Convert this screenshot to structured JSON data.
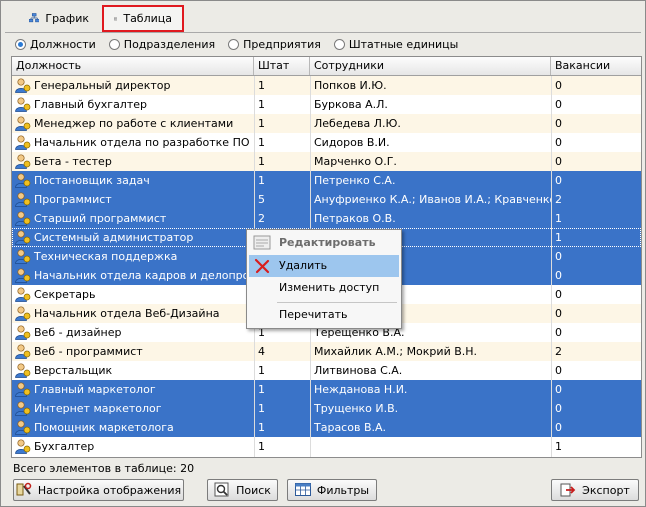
{
  "tabs": [
    {
      "label": "График",
      "icon": "hierarchy-icon"
    },
    {
      "label": "Таблица",
      "icon": "table-icon",
      "active": true
    }
  ],
  "view_modes": [
    {
      "label": "Должности",
      "selected": true
    },
    {
      "label": "Подразделения",
      "selected": false
    },
    {
      "label": "Предприятия",
      "selected": false
    },
    {
      "label": "Штатные единицы",
      "selected": false
    }
  ],
  "table": {
    "columns": [
      "Должность",
      "Штат",
      "Сотрудники",
      "Вакансии"
    ],
    "rows": [
      {
        "position": "Генеральный директор",
        "staff": "1",
        "employees": "Попков И.Ю.",
        "vacancies": "0",
        "selected": false
      },
      {
        "position": "Главный бухгалтер",
        "staff": "1",
        "employees": "Буркова А.Л.",
        "vacancies": "0",
        "selected": false
      },
      {
        "position": "Менеджер по работе с клиентами",
        "staff": "1",
        "employees": "Лебедева Л.Ю.",
        "vacancies": "0",
        "selected": false
      },
      {
        "position": "Начальник отдела по разработке ПО",
        "staff": "1",
        "employees": "Сидоров В.И.",
        "vacancies": "0",
        "selected": false
      },
      {
        "position": "Бета - тестер",
        "staff": "1",
        "employees": "Марченко О.Г.",
        "vacancies": "0",
        "selected": false
      },
      {
        "position": "Постановщик задач",
        "staff": "1",
        "employees": "Петренко С.А.",
        "vacancies": "0",
        "selected": true
      },
      {
        "position": "Программист",
        "staff": "5",
        "employees": "Ануфриенко К.А.; Иванов И.А.; Кравченко О.П",
        "vacancies": "2",
        "selected": true
      },
      {
        "position": "Старший программист",
        "staff": "2",
        "employees": "Петраков О.В.",
        "vacancies": "1",
        "selected": true
      },
      {
        "position": "Системный администратор",
        "staff": "",
        "employees": "",
        "vacancies": "1",
        "selected": true,
        "focused": true
      },
      {
        "position": "Техническая поддержка",
        "staff": "",
        "employees": "",
        "vacancies": "0",
        "selected": true
      },
      {
        "position": "Начальник отдела кадров и делопроизво",
        "staff": "",
        "employees": "",
        "vacancies": "0",
        "selected": true
      },
      {
        "position": "Секретарь",
        "staff": "",
        "employees": "",
        "vacancies": "0",
        "selected": false
      },
      {
        "position": "Начальник отдела Веб-Дизайна",
        "staff": "",
        "employees": "",
        "vacancies": "0",
        "selected": false
      },
      {
        "position": "Веб - дизайнер",
        "staff": "1",
        "employees": "Терещенко В.А.",
        "vacancies": "0",
        "selected": false
      },
      {
        "position": "Веб - программист",
        "staff": "4",
        "employees": "Михайлик А.М.; Мокрий В.Н.",
        "vacancies": "2",
        "selected": false
      },
      {
        "position": "Верстальщик",
        "staff": "1",
        "employees": "Литвинова С.А.",
        "vacancies": "0",
        "selected": false
      },
      {
        "position": "Главный маркетолог",
        "staff": "1",
        "employees": "Нежданова Н.И.",
        "vacancies": "0",
        "selected": true
      },
      {
        "position": "Интернет маркетолог",
        "staff": "1",
        "employees": "Трущенко И.В.",
        "vacancies": "0",
        "selected": true
      },
      {
        "position": "Помощник маркетолога",
        "staff": "1",
        "employees": "Тарасов В.А.",
        "vacancies": "0",
        "selected": true
      },
      {
        "position": "Бухгалтер",
        "staff": "1",
        "employees": "",
        "vacancies": "1",
        "selected": false
      }
    ]
  },
  "context_menu": {
    "items": [
      {
        "label": "Редактировать",
        "disabled": true,
        "icon": "edit-icon"
      },
      {
        "label": "Удалить",
        "highlighted": true,
        "icon": "delete-icon"
      },
      {
        "label": "Изменить доступ"
      },
      {
        "label": "Перечитать"
      }
    ]
  },
  "status": {
    "text": "Всего элементов в таблице: 20"
  },
  "buttons": [
    {
      "label": "Настройка отображения",
      "icon": "settings-icon"
    },
    {
      "label": "Поиск",
      "icon": "search-icon"
    },
    {
      "label": "Фильтры",
      "icon": "filter-icon"
    },
    {
      "label": "Экспорт",
      "icon": "export-icon"
    }
  ],
  "colors": {
    "selection": "#3a73c8",
    "menu_highlight": "#9dc6ee",
    "active_tab_border": "#e0191f",
    "alt_row": "#fdf6e6"
  }
}
